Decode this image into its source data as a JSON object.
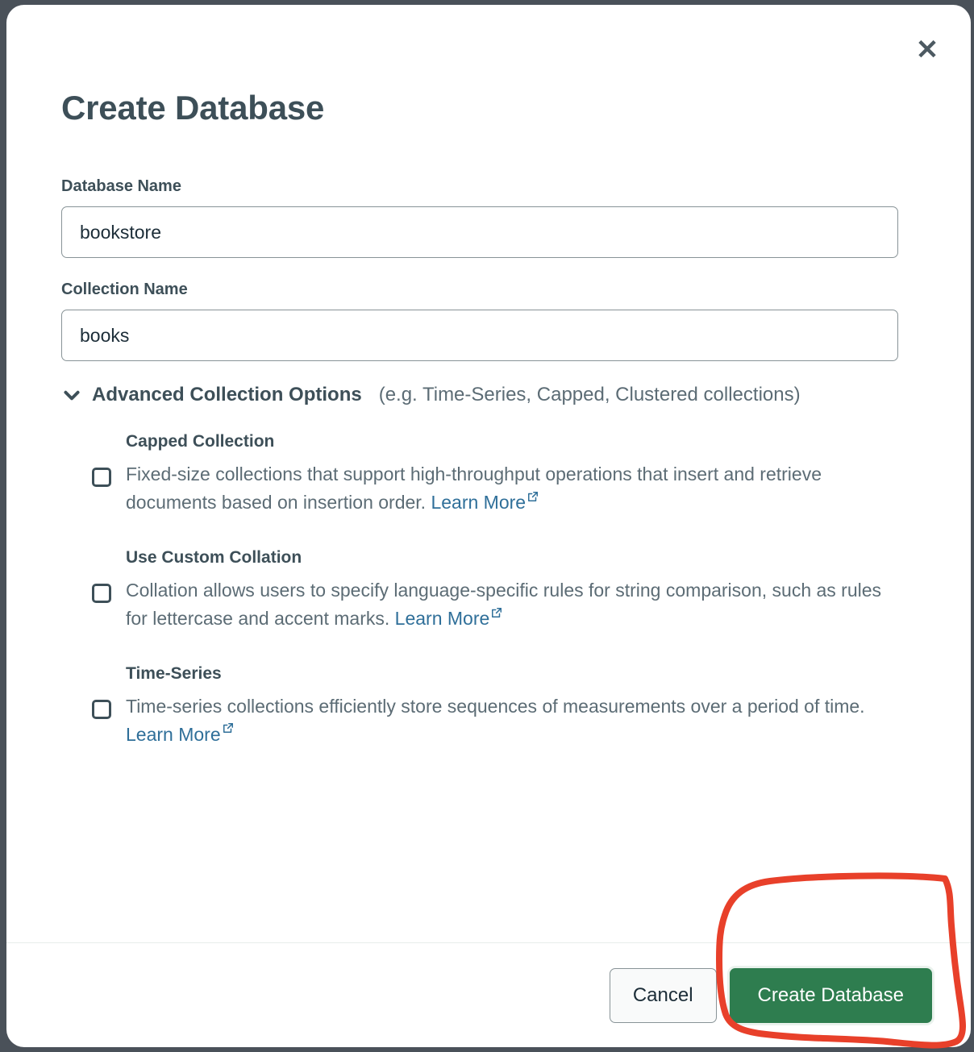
{
  "modal": {
    "title": "Create Database",
    "close_icon": "close-icon",
    "close_label": "✕"
  },
  "fields": {
    "database_name": {
      "label": "Database Name",
      "value": "bookstore",
      "placeholder": "Database Name"
    },
    "collection_name": {
      "label": "Collection Name",
      "value": "books",
      "placeholder": "Collection Name"
    }
  },
  "advanced": {
    "chevron_icon": "chevron-down-icon",
    "title": "Advanced Collection Options",
    "note": "(e.g. Time-Series, Capped, Clustered collections)",
    "expanded": true,
    "options": [
      {
        "title": "Capped Collection",
        "checked": false,
        "description": "Fixed-size collections that support high-throughput operations that insert and retrieve documents based on insertion order.",
        "link_label": "Learn More",
        "link_icon": "external-link-icon"
      },
      {
        "title": "Use Custom Collation",
        "checked": false,
        "description": "Collation allows users to specify language-specific rules for string comparison, such as rules for lettercase and accent marks.",
        "link_label": "Learn More",
        "link_icon": "external-link-icon"
      },
      {
        "title": "Time-Series",
        "checked": false,
        "description": "Time-series collections efficiently store sequences of measurements over a period of time.",
        "link_label": "Learn More",
        "link_icon": "external-link-icon"
      }
    ]
  },
  "footer": {
    "cancel_label": "Cancel",
    "create_label": "Create Database"
  },
  "colors": {
    "backdrop": "#4a5159",
    "primary_green": "#2e7d4f",
    "link_blue": "#2f6f99",
    "text_dark": "#3d4f58",
    "text_muted": "#5c6c75",
    "border_gray": "#889397",
    "annotation_red": "#e8402a"
  },
  "annotation": {
    "shape": "hand-drawn-circle",
    "target": "create-database-button",
    "color": "#e8402a"
  }
}
